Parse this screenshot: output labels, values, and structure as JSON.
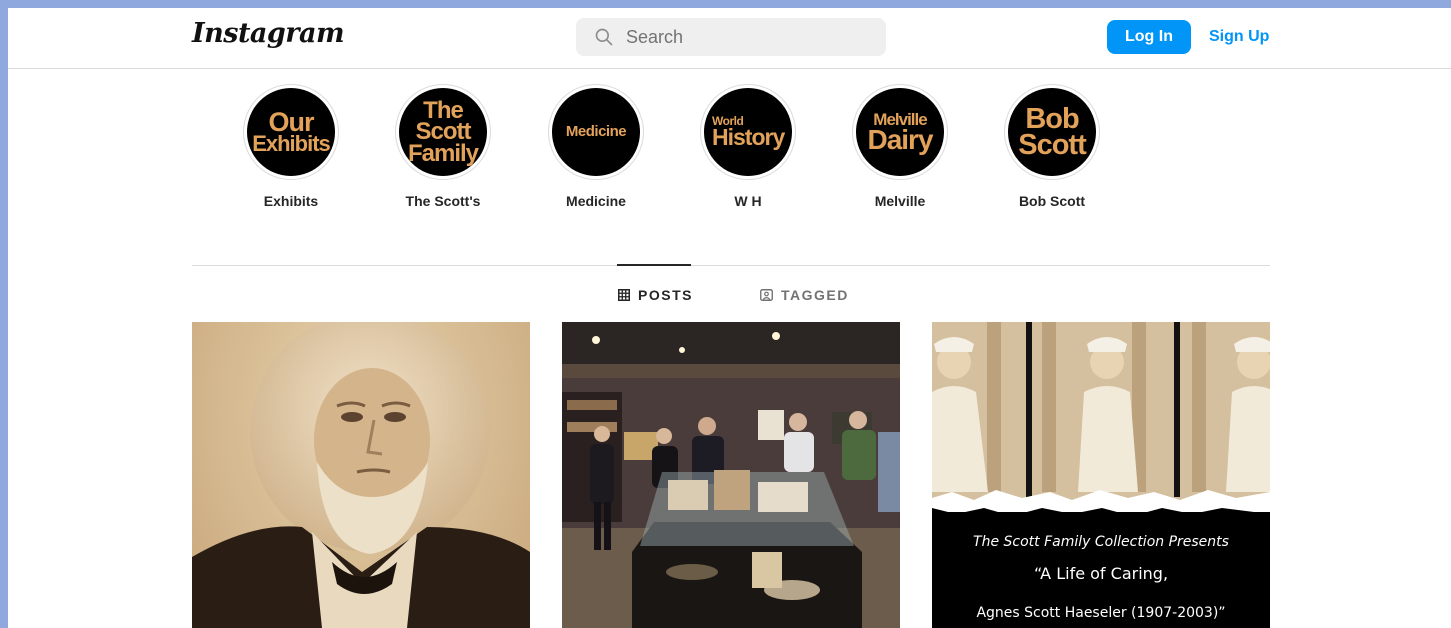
{
  "header": {
    "logo_text": "Instagram",
    "search_placeholder": "Search",
    "login_label": "Log In",
    "signup_label": "Sign Up"
  },
  "highlights": [
    {
      "cover_lines": [
        "Our",
        "Exhibits"
      ],
      "label": "Exhibits"
    },
    {
      "cover_lines": [
        "The",
        "Scott",
        "Family"
      ],
      "label": "The Scott's"
    },
    {
      "cover_lines": [
        "Medicine"
      ],
      "label": "Medicine"
    },
    {
      "cover_lines": [
        "World",
        "History"
      ],
      "label": "W H"
    },
    {
      "cover_lines": [
        "Melville",
        "Dairy"
      ],
      "label": "Melville"
    },
    {
      "cover_lines": [
        "Bob",
        "Scott"
      ],
      "label": "Bob Scott"
    }
  ],
  "tabs": [
    {
      "label": "POSTS",
      "active": true,
      "icon": "grid-icon"
    },
    {
      "label": "TAGGED",
      "active": false,
      "icon": "tagged-icon"
    }
  ],
  "posts": [
    {
      "kind": "photo",
      "subject": "sepia-portrait"
    },
    {
      "kind": "photo",
      "subject": "exhibit-room"
    },
    {
      "kind": "graphic",
      "caption_line1": "The Scott Family Collection Presents",
      "caption_line2": "“A Life of Caring,",
      "caption_line3": "Agnes Scott Haeseler (1907-2003)”"
    }
  ],
  "colors": {
    "accent": "#0095f6",
    "highlight_text": "#e3a25a",
    "page_border": "#8fa9df"
  }
}
